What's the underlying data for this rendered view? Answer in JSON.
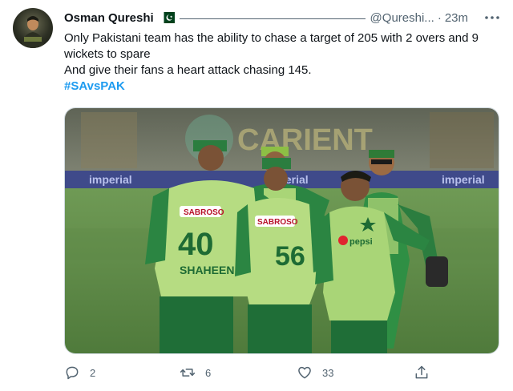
{
  "tweet": {
    "author_name": "Osman Qureshi",
    "handle": "@Qureshi...",
    "separator": "·",
    "time": "23m",
    "text_lines": [
      "Only Pakistani team has the ability to chase a target of 205 with 2 overs and 9 wickets to spare",
      "And give their fans a heart attack chasing 145."
    ],
    "hashtag": "#SAvsPAK",
    "icons": {
      "avatar": "avatar-photo",
      "flag": "pakistan-flag-icon",
      "more": "more-horizontal-icon",
      "reply": "reply-icon",
      "retweet": "retweet-icon",
      "like": "heart-icon",
      "share": "share-icon"
    },
    "media": {
      "banner_text": "CARIENT",
      "board_text_left": "imperial",
      "board_text_mid": "imperial",
      "board_text_right": "imperial",
      "jersey_sponsor": "SABROSO",
      "player1_number": "40",
      "player1_name": "SHAHEEN",
      "player2_number": "56",
      "jersey_sponsor_3": "pepsi"
    },
    "stats": {
      "replies": "2",
      "retweets": "6",
      "likes": "33"
    },
    "colors": {
      "link": "#1d9bf0",
      "secondary": "#536471",
      "jersey_green": "#1f7a3a",
      "jersey_lime": "#b9e08a"
    }
  }
}
